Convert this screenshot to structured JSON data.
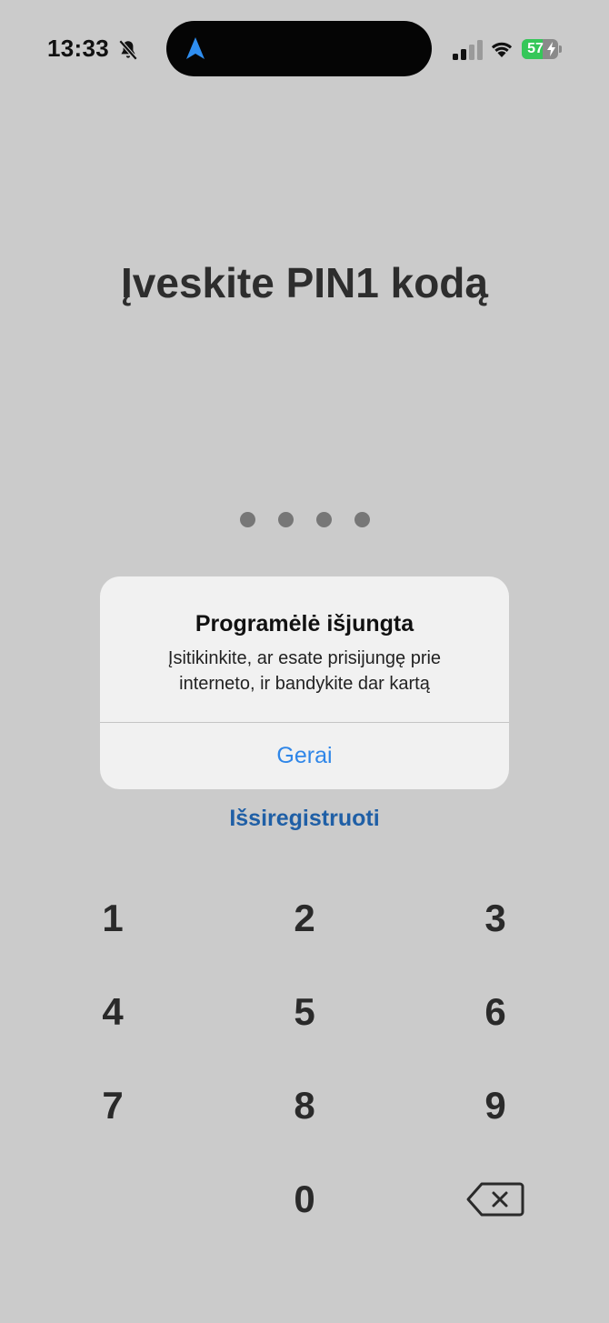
{
  "status_bar": {
    "time": "13:33",
    "battery_level": "57",
    "battery_fraction": 0.57,
    "icons": [
      "bell-slash-icon",
      "location-arrow-icon",
      "cellular-signal-icon",
      "wifi-icon",
      "battery-charging-icon"
    ]
  },
  "title": "Įveskite PIN1 kodą",
  "pin": {
    "length": 4,
    "entered": 4
  },
  "alert": {
    "title": "Programėlė išjungta",
    "message_line1": "Įsitikinkite, ar esate prisijungę prie",
    "message_line2": "interneto, ir bandykite dar kartą",
    "button_label": "Gerai"
  },
  "logout_label": "Išsiregistruoti",
  "keypad": {
    "keys": [
      "1",
      "2",
      "3",
      "4",
      "5",
      "6",
      "7",
      "8",
      "9",
      "0"
    ],
    "backspace_icon": "backspace-icon"
  },
  "colors": {
    "background": "#cbcbcb",
    "alert_button": "#2f86e8",
    "link": "#1f5fa6",
    "battery": "#35c759"
  }
}
